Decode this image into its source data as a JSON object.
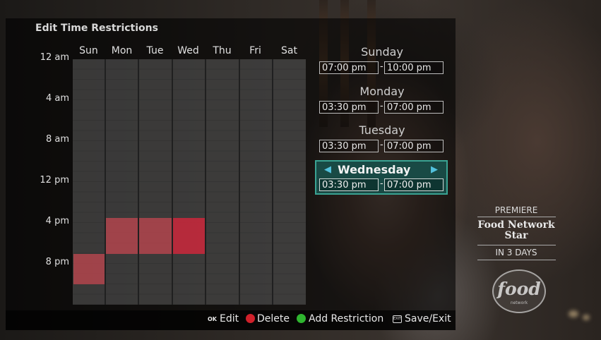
{
  "screen": {
    "title": "Edit Time Restrictions"
  },
  "grid": {
    "days": [
      "Sun",
      "Mon",
      "Tue",
      "Wed",
      "Thu",
      "Fri",
      "Sat"
    ],
    "time_labels": [
      "12 am",
      "4 am",
      "8 am",
      "12 pm",
      "4 pm",
      "8 pm"
    ],
    "restriction_color": "#c84650"
  },
  "restrictions": [
    {
      "day": "Sunday",
      "start": "07:00 pm",
      "end": "10:00 pm"
    },
    {
      "day": "Monday",
      "start": "03:30 pm",
      "end": "07:00 pm"
    },
    {
      "day": "Tuesday",
      "start": "03:30 pm",
      "end": "07:00 pm"
    },
    {
      "day": "Wednesday",
      "start": "03:30 pm",
      "end": "07:00 pm",
      "selected": true
    }
  ],
  "separator": "-",
  "selected_colors": {
    "card": "#194a45",
    "border": "#3aa393",
    "arrows": "#53c1dd"
  },
  "arrows": {
    "left": "◀",
    "right": "▶"
  },
  "promo": {
    "tag": "PREMIERE",
    "show": "Food Network Star",
    "when": "IN 3 DAYS",
    "logo_text": "food",
    "logo_sub": "network"
  },
  "footer": {
    "ok_key": "OK",
    "edit": "Edit",
    "delete": "Delete",
    "add": "Add Restriction",
    "exit_key": "EXIT",
    "save_exit": "Save/Exit",
    "red": "#d0202a",
    "green": "#2fb52f"
  }
}
